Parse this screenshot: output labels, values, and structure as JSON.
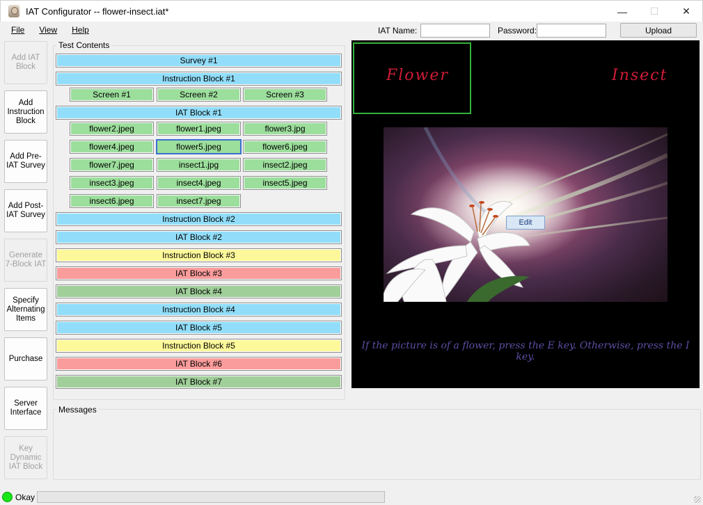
{
  "window": {
    "title": "IAT Configurator -- flower-insect.iat*",
    "minimize": "—",
    "maximize": "☐",
    "close": "✕"
  },
  "menu": {
    "file": "File",
    "view": "View",
    "help": "Help"
  },
  "header": {
    "iat_name_label": "IAT Name:",
    "iat_name_value": "",
    "password_label": "Password:",
    "password_value": "",
    "upload_label": "Upload"
  },
  "sidebar": {
    "items": [
      {
        "label": "Add IAT Block",
        "enabled": false
      },
      {
        "label": "Add Instruction Block",
        "enabled": true
      },
      {
        "label": "Add Pre-IAT Survey",
        "enabled": true
      },
      {
        "label": "Add Post-IAT Survey",
        "enabled": true
      },
      {
        "label": "Generate 7-Block IAT",
        "enabled": false
      },
      {
        "label": "Specify Alternating Items",
        "enabled": true
      },
      {
        "label": "Purchase",
        "enabled": true
      },
      {
        "label": "Server Interface",
        "enabled": true
      },
      {
        "label": "Key Dynamic IAT Block",
        "enabled": false
      }
    ]
  },
  "test_contents": {
    "label": "Test Contents",
    "survey1": "Survey #1",
    "instr1": "Instruction Block #1",
    "screens": [
      "Screen #1",
      "Screen #2",
      "Screen #3"
    ],
    "iat1": "IAT Block #1",
    "stimuli": [
      "flower2.jpeg",
      "flower1.jpeg",
      "flower3.jpg",
      "flower4.jpeg",
      "flower5.jpeg",
      "flower6.jpeg",
      "flower7.jpeg",
      "insect1.jpg",
      "insect2.jpeg",
      "insect3.jpeg",
      "insect4.jpeg",
      "insect5.jpeg",
      "insect6.jpeg",
      "insect7.jpeg"
    ],
    "blocks_after": [
      {
        "label": "Instruction Block #2",
        "color": "blue"
      },
      {
        "label": "IAT Block #2",
        "color": "blue"
      },
      {
        "label": "Instruction Block #3",
        "color": "yellow"
      },
      {
        "label": "IAT Block #3",
        "color": "red"
      },
      {
        "label": "IAT Block #4",
        "color": "dgreen"
      },
      {
        "label": "Instruction Block #4",
        "color": "blue"
      },
      {
        "label": "IAT Block #5",
        "color": "blue"
      },
      {
        "label": "Instruction Block #5",
        "color": "yellow"
      },
      {
        "label": "IAT Block #6",
        "color": "red"
      },
      {
        "label": "IAT Block #7",
        "color": "dgreen"
      }
    ],
    "selected_stimulus": "flower5.jpeg"
  },
  "preview": {
    "left_key": "Flower",
    "right_key": "Insect",
    "edit_label": "Edit",
    "instructions": "If the picture is of a flower, press the E key. Otherwise, press the I key."
  },
  "messages": {
    "label": "Messages"
  },
  "status": {
    "text": "Okay",
    "progress": 0
  },
  "colors": {
    "blue": "#92defa",
    "green": "#9cde9c",
    "yellow": "#fdf89a",
    "red": "#fb9c9c",
    "dgreen": "#a0cf9a",
    "key_text": "#d11c37",
    "instruction_text": "#5d4ea3",
    "status_ok": "#19e619"
  }
}
